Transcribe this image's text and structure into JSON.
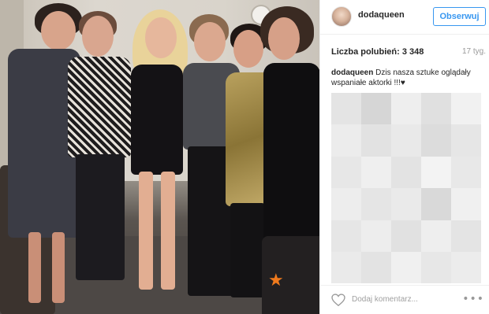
{
  "photo": {
    "description_icon": "photo-image"
  },
  "header": {
    "username": "dodaqueen",
    "follow_label": "Obserwuj",
    "avatar_icon": "avatar-icon"
  },
  "stats": {
    "likes": "Liczba polubień: 3 348",
    "age": "17 tyg."
  },
  "comment": {
    "author": "dodaqueen",
    "text": "Dzis nasza sztuke oglądały wspaniałe aktorki !!!♥"
  },
  "footer": {
    "like_icon": "heart-icon",
    "add_comment_placeholder": "Dodaj komentarz...",
    "more_icon": "more-options-icon",
    "more_glyph": "•••"
  },
  "colors": {
    "accent": "#3897f0",
    "muted": "#999999",
    "divider": "#efefef"
  }
}
